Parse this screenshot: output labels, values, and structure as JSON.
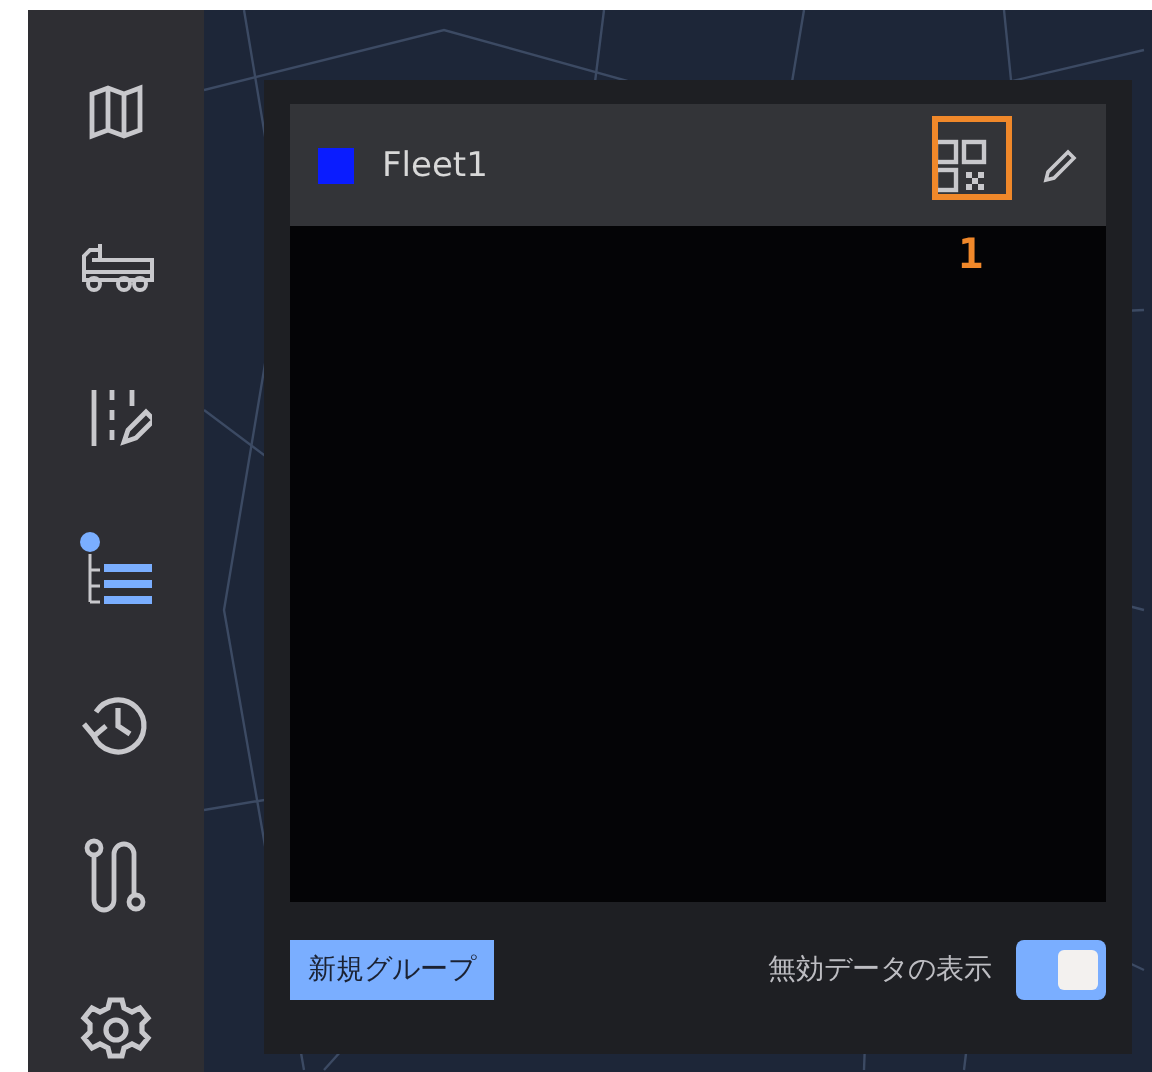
{
  "sidebar": {
    "items": [
      {
        "kind": "map",
        "selected": false
      },
      {
        "kind": "truck",
        "selected": false
      },
      {
        "kind": "lanes",
        "selected": false
      },
      {
        "kind": "tree",
        "selected": true
      },
      {
        "kind": "history",
        "selected": false
      },
      {
        "kind": "route",
        "selected": false
      },
      {
        "kind": "settings",
        "selected": false
      }
    ]
  },
  "panel": {
    "groups": [
      {
        "name": "Fleet1",
        "color": "#0a1cff"
      }
    ],
    "callout": {
      "label": "1"
    },
    "new_group_button": "新規グループ",
    "show_invalid": {
      "label": "無効データの表示",
      "on": true
    }
  }
}
